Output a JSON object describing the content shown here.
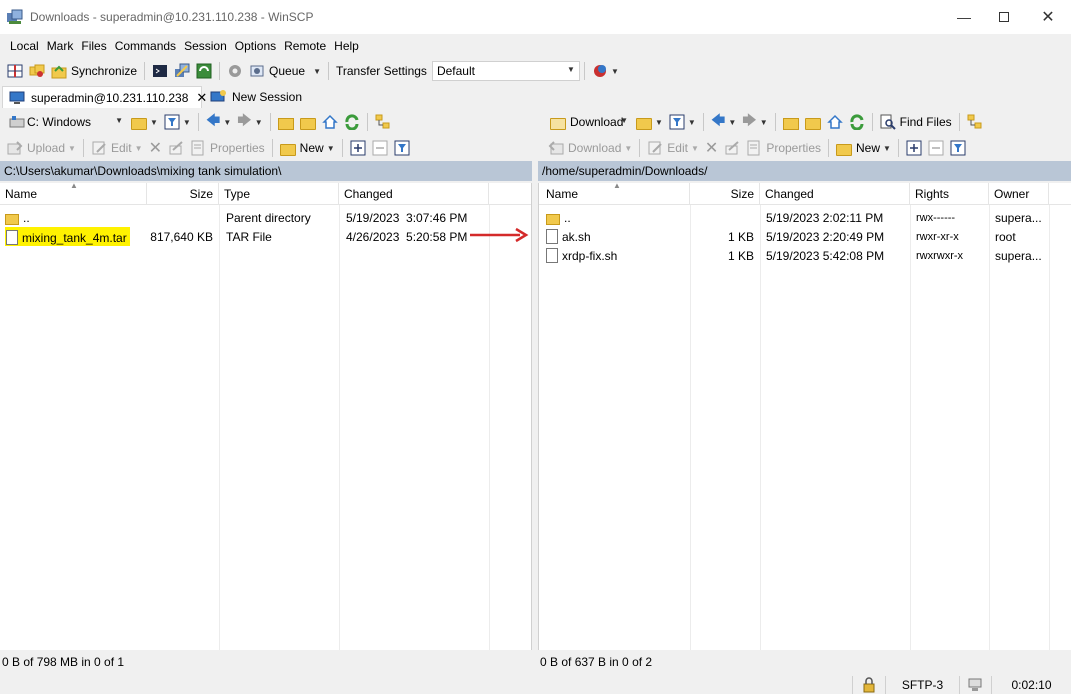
{
  "window": {
    "title": "Downloads - superadmin@10.231.110.238 - WinSCP"
  },
  "menu": [
    "Local",
    "Mark",
    "Files",
    "Commands",
    "Session",
    "Options",
    "Remote",
    "Help"
  ],
  "toolbar": {
    "synchronize": "Synchronize",
    "queue": "Queue",
    "transfer_settings_label": "Transfer Settings",
    "transfer_settings_value": "Default"
  },
  "tabs": {
    "session": "superadmin@10.231.110.238",
    "new_session": "New Session"
  },
  "local": {
    "drive": "C: Windows",
    "actions": {
      "upload": "Upload",
      "edit": "Edit",
      "properties": "Properties",
      "new": "New"
    },
    "path": "C:\\Users\\akumar\\Downloads\\mixing tank simulation\\",
    "columns": {
      "name": "Name",
      "size": "Size",
      "type": "Type",
      "changed": "Changed"
    },
    "files": [
      {
        "name": "..",
        "size": "",
        "type": "Parent directory",
        "changed": "5/19/2023  3:07:46 PM"
      },
      {
        "name": "mixing_tank_4m.tar",
        "size": "817,640 KB",
        "type": "TAR File",
        "changed": "4/26/2023  5:20:58 PM"
      }
    ],
    "status": "0 B of 798 MB in 0 of 1"
  },
  "remote": {
    "folder": "Download",
    "actions": {
      "download": "Download",
      "edit": "Edit",
      "properties": "Properties",
      "new": "New",
      "find_files": "Find Files"
    },
    "path": "/home/superadmin/Downloads/",
    "columns": {
      "name": "Name",
      "size": "Size",
      "changed": "Changed",
      "rights": "Rights",
      "owner": "Owner"
    },
    "files": [
      {
        "name": "..",
        "size": "",
        "changed": "5/19/2023 2:02:11 PM",
        "rights": "rwx------",
        "owner": "supera..."
      },
      {
        "name": "ak.sh",
        "size": "1 KB",
        "changed": "5/19/2023 2:20:49 PM",
        "rights": "rwxr-xr-x",
        "owner": "root"
      },
      {
        "name": "xrdp-fix.sh",
        "size": "1 KB",
        "changed": "5/19/2023 5:42:08 PM",
        "rights": "rwxrwxr-x",
        "owner": "supera..."
      }
    ],
    "status": "0 B of 637 B in 0 of 2"
  },
  "statusbar": {
    "protocol": "SFTP-3",
    "elapsed": "0:02:10"
  },
  "colors": {
    "path_bar": "#b9c6d6",
    "highlight": "#fff200",
    "arrow": "#d42a2a",
    "folder": "#f1c94c"
  }
}
